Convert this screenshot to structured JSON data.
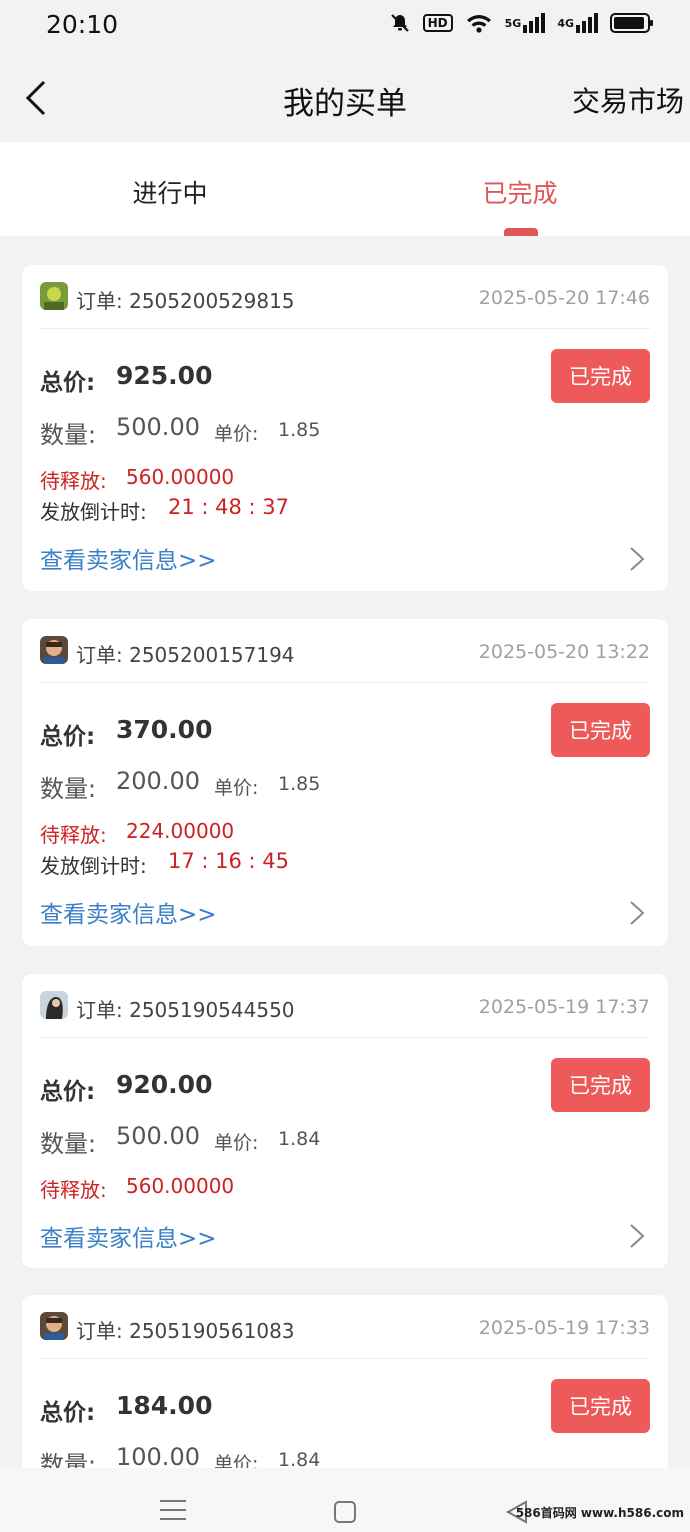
{
  "status_bar": {
    "time": "20:10",
    "hd_label": "HD",
    "sig1": "5G",
    "sig2": "4G"
  },
  "nav": {
    "title": "我的买单",
    "right_link": "交易市场"
  },
  "tabs": [
    {
      "label": "进行中"
    },
    {
      "label": "已完成"
    }
  ],
  "active_tab": 1,
  "labels": {
    "total": "总价:",
    "quantity": "数量:",
    "unit_price": "单价:",
    "pending": "待释放:",
    "countdown": "发放倒计时:",
    "seller_link": "查看卖家信息>>"
  },
  "orders": [
    {
      "order_no": "订单: 2505200529815",
      "time": "2025-05-20 17:46",
      "total": "925.00",
      "status": "已完成",
      "quantity": "500.00",
      "unit_price": "1.85",
      "pending": "560.00000",
      "countdown": "21 : 48 : 37"
    },
    {
      "order_no": "订单: 2505200157194",
      "time": "2025-05-20 13:22",
      "total": "370.00",
      "status": "已完成",
      "quantity": "200.00",
      "unit_price": "1.85",
      "pending": "224.00000",
      "countdown": "17 : 16 : 45"
    },
    {
      "order_no": "订单: 2505190544550",
      "time": "2025-05-19 17:37",
      "total": "920.00",
      "status": "已完成",
      "quantity": "500.00",
      "unit_price": "1.84",
      "pending": "560.00000"
    },
    {
      "order_no": "订单: 2505190561083",
      "time": "2025-05-19 17:33",
      "total": "184.00",
      "status": "已完成",
      "quantity": "100.00",
      "unit_price": "1.84"
    }
  ],
  "watermark": "586首码网 www.h586.com",
  "colors": {
    "accent": "#ee5a5a",
    "link": "#3a7fc8",
    "pending": "#cc2222"
  }
}
